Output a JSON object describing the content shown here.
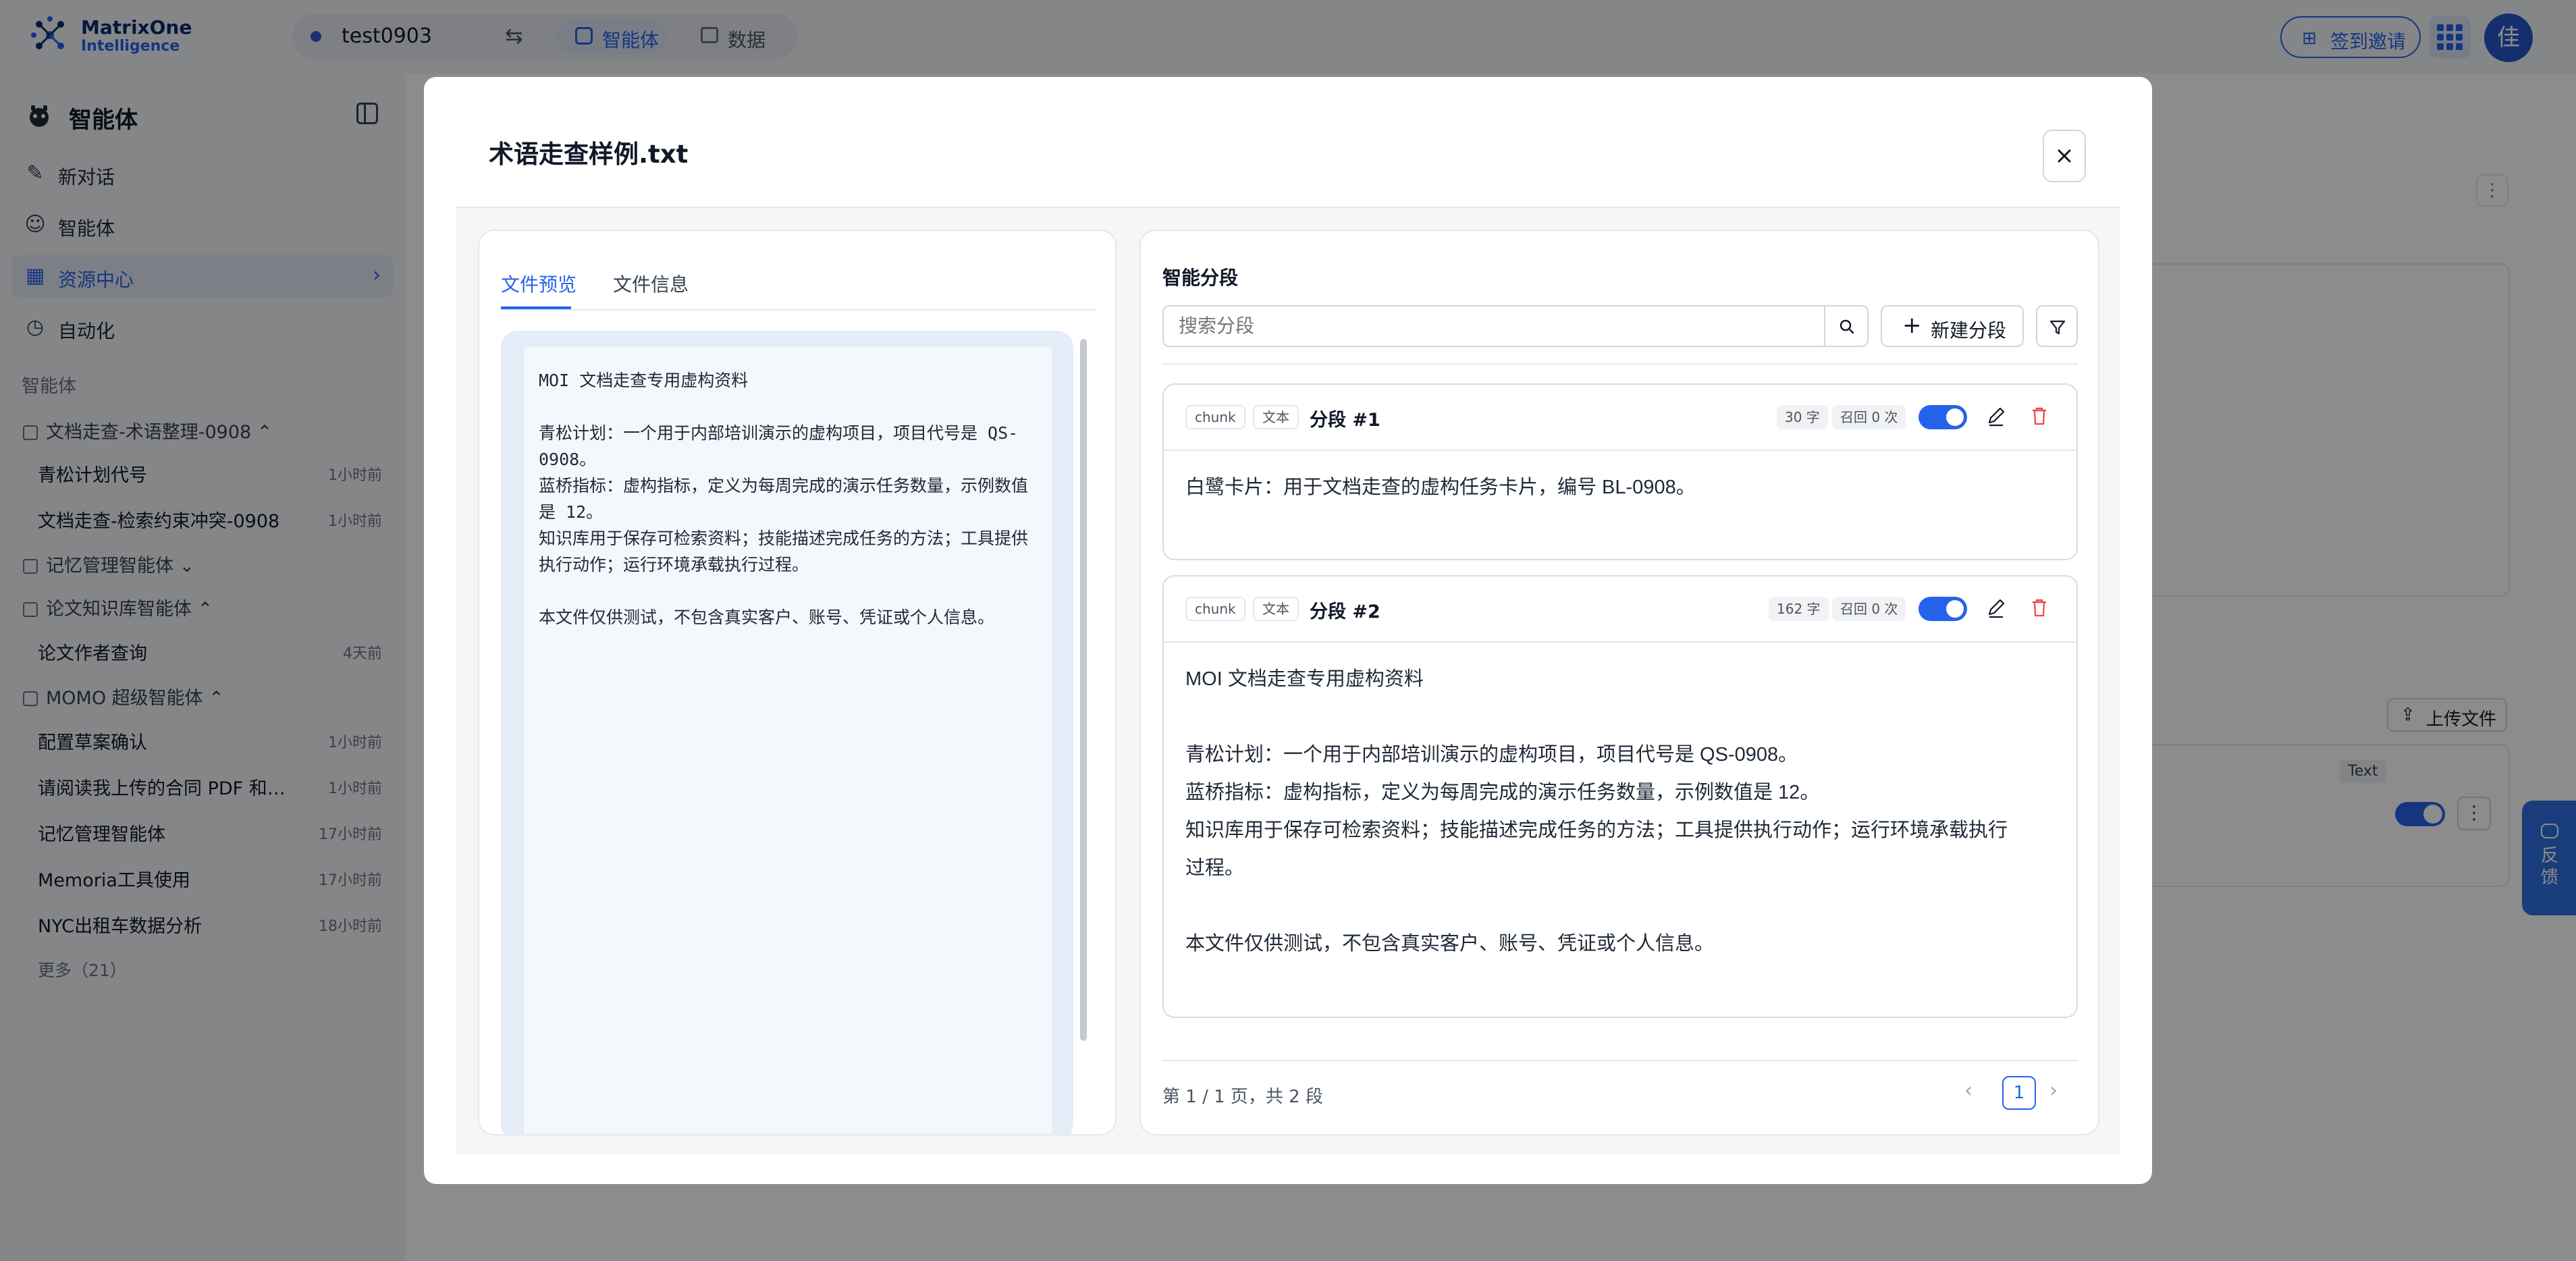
{
  "brand": {
    "line1": "MatrixOne",
    "line2": "Intelligence"
  },
  "workspace": {
    "name": "test0903",
    "swap_icon": "swap-icon"
  },
  "topnav": {
    "agents_label": "智能体",
    "data_label": "数据"
  },
  "header": {
    "invite_label": "签到邀请",
    "avatar_initial": "佳"
  },
  "sidebar": {
    "title": "智能体",
    "items": [
      {
        "label": "新对话",
        "icon": "new-chat-icon"
      },
      {
        "label": "智能体",
        "icon": "robot-icon"
      },
      {
        "label": "资源中心",
        "icon": "grid-icon",
        "active": true
      },
      {
        "label": "自动化",
        "icon": "clock-icon"
      }
    ],
    "section_label": "智能体",
    "groups": [
      {
        "name": "文档走查-术语整理-0908",
        "conversations": [
          {
            "title": "青松计划代号",
            "time": "1小时前"
          },
          {
            "title": "文档走查-检索约束冲突-0908",
            "time": "1小时前"
          }
        ]
      },
      {
        "name": "记忆管理智能体",
        "conversations": []
      },
      {
        "name": "论文知识库智能体",
        "conversations": [
          {
            "title": "论文作者查询",
            "time": "4天前"
          }
        ]
      },
      {
        "name": "MOMO 超级智能体",
        "conversations": [
          {
            "title": "配置草案确认",
            "time": "1小时前"
          },
          {
            "title": "请阅读我上传的合同 PDF 和审计材料",
            "time": "1小时前"
          },
          {
            "title": "记忆管理智能体",
            "time": "17小时前"
          },
          {
            "title": "Memoria工具使用",
            "time": "17小时前"
          },
          {
            "title": "NYC出租车数据分析",
            "time": "18小时前"
          }
        ]
      }
    ],
    "more_label": "更多（21）"
  },
  "background": {
    "upload_label": "上传文件",
    "tag_label": "Text",
    "feedback_label": "反馈"
  },
  "modal": {
    "title": "术语走查样例.txt",
    "tabs": [
      {
        "label": "文件预览"
      },
      {
        "label": "文件信息"
      }
    ],
    "preview_text": "MOI 文档走查专用虚构资料\n\n青松计划：一个用于内部培训演示的虚构项目，项目代号是 QS-0908。\n蓝桥指标：虚构指标，定义为每周完成的演示任务数量，示例数值是 12。\n知识库用于保存可检索资料；技能描述完成任务的方法；工具提供执行动作；运行环境承载执行过程。\n\n本文件仅供测试，不包含真实客户、账号、凭证或个人信息。",
    "segments_title": "智能分段",
    "search_placeholder": "搜索分段",
    "new_segment_label": "新建分段",
    "segments": [
      {
        "chip1": "chunk",
        "chip2": "文本",
        "title": "分段 #1",
        "chars": "30 字",
        "recall": "召回 0 次",
        "enabled": true,
        "content": "白鹭卡片：用于文档走查的虚构任务卡片，编号 BL-0908。"
      },
      {
        "chip1": "chunk",
        "chip2": "文本",
        "title": "分段 #2",
        "chars": "162 字",
        "recall": "召回 0 次",
        "enabled": true,
        "content": "MOI 文档走查专用虚构资料\n\n青松计划：一个用于内部培训演示的虚构项目，项目代号是 QS-0908。\n蓝桥指标：虚构指标，定义为每周完成的演示任务数量，示例数值是 12。\n知识库用于保存可检索资料；技能描述完成任务的方法；工具提供执行动作；运行环境承载执行\n过程。\n\n本文件仅供测试，不包含真实客户、账号、凭证或个人信息。"
      }
    ],
    "pagination": {
      "info": "第 1 / 1 页，共 2 段",
      "current": "1"
    }
  },
  "colors": {
    "accent": "#2563eb",
    "danger": "#ef4444",
    "overlay": "rgba(0,0,0,0.45)"
  }
}
